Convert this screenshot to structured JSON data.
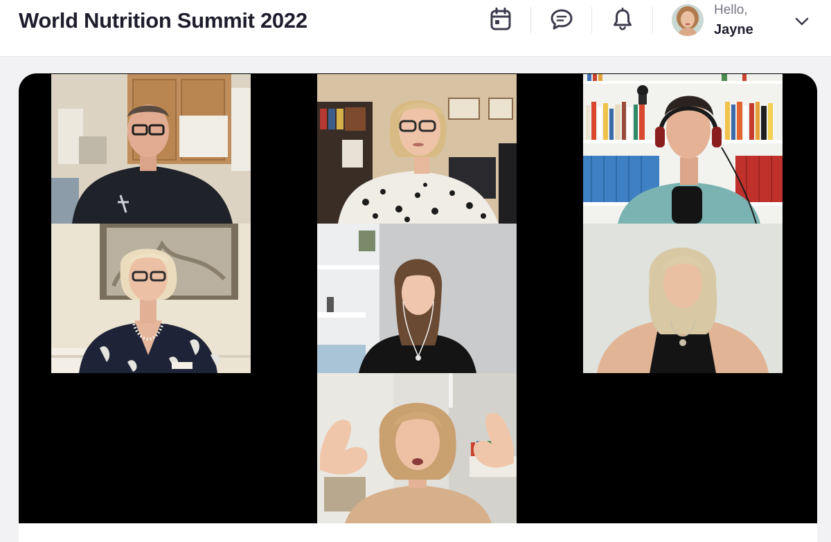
{
  "header": {
    "title": "World Nutrition Summit 2022",
    "greeting": "Hello,",
    "user_name": "Jayne"
  },
  "icons": {
    "calendar": "calendar-icon",
    "chat": "chat-icon",
    "notifications": "bell-icon",
    "menu": "chevron-down-icon"
  },
  "colors": {
    "title_text": "#1d1d2c",
    "icon": "#3a3a4c",
    "stage_background": "#000000",
    "page_background": "#f2f2f4"
  },
  "video_grid": {
    "participant_count": 7
  }
}
